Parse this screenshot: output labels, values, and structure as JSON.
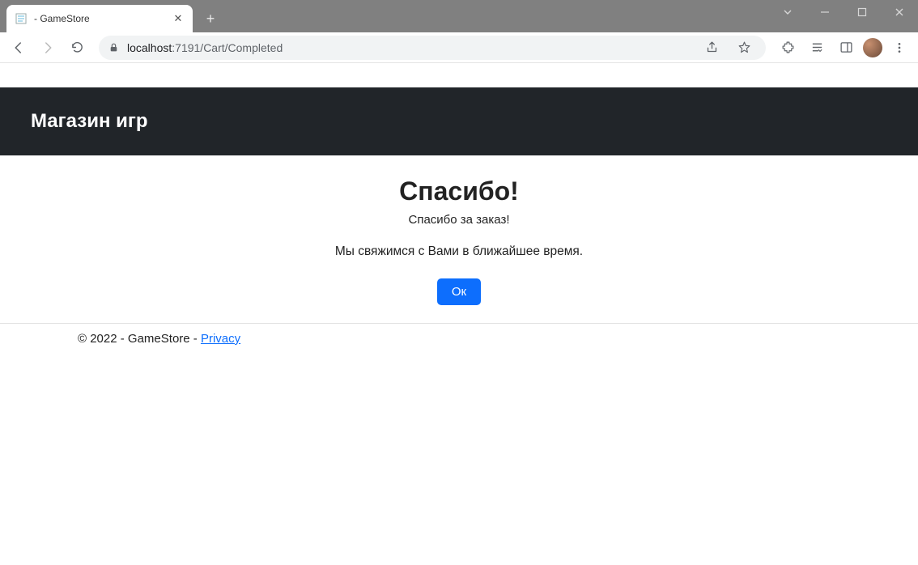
{
  "browser": {
    "tab_title": " - GameStore",
    "url_host": "localhost",
    "url_port_path": ":7191/Cart/Completed"
  },
  "navbar": {
    "brand": "Магазин игр"
  },
  "content": {
    "heading": "Спасибо!",
    "subtitle": "Спасибо за заказ!",
    "message": "Мы свяжимся с Вами в ближайшее время.",
    "ok_label": "Ок"
  },
  "footer": {
    "text": "© 2022 - GameStore - ",
    "privacy_label": "Privacy"
  }
}
